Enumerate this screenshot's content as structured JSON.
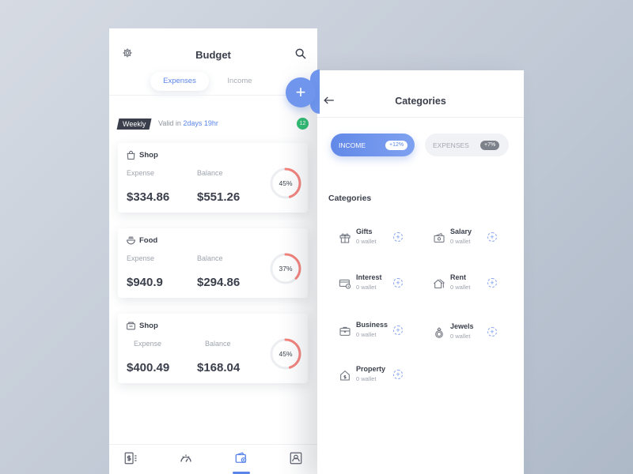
{
  "budget": {
    "title": "Budget",
    "tabs": [
      {
        "label": "Expenses",
        "active": true
      },
      {
        "label": "Income",
        "active": false
      }
    ],
    "fab_label": "+",
    "period_tag": "Weekly",
    "valid_prefix": "Valid in ",
    "valid_time": "2days 19hr",
    "count_badge": "12",
    "cards": [
      {
        "title": "Shop",
        "icon": "shopping-bag-icon",
        "expense_label": "Expense",
        "balance_label": "Balance",
        "expense": "$334.86",
        "balance": "$551.26",
        "percent_label": "45%",
        "percent": 45
      },
      {
        "title": "Food",
        "icon": "bowl-icon",
        "expense_label": "Expense",
        "balance_label": "Balance",
        "expense": "$940.9",
        "balance": "$294.86",
        "percent_label": "37%",
        "percent": 37
      },
      {
        "title": "Shop",
        "icon": "register-icon",
        "expense_label": "Expense",
        "balance_label": "Balance",
        "expense": "$400.49",
        "balance": "$168.04",
        "percent_label": "45%",
        "percent": 45
      }
    ],
    "nav": [
      "budget-list-icon",
      "speedometer-icon",
      "wallet-icon",
      "profile-icon"
    ],
    "active_nav": 2
  },
  "categories": {
    "title": "Categories",
    "toggle": {
      "income_label": "INCOME",
      "income_badge": "+12%",
      "expenses_label": "EXPENSES",
      "expenses_badge": "+7%"
    },
    "section_title": "Categories",
    "items": [
      {
        "name": "Gifts",
        "sub": "0 wallet",
        "icon": "gift-icon"
      },
      {
        "name": "Salary",
        "sub": "0 wallet",
        "icon": "cash-icon"
      },
      {
        "name": "Interest",
        "sub": "0 wallet",
        "icon": "card-icon"
      },
      {
        "name": "Rent",
        "sub": "0 wallet",
        "icon": "house-icon"
      },
      {
        "name": "Business",
        "sub": "0 wallet",
        "icon": "briefcase-icon"
      },
      {
        "name": "Jewels",
        "sub": "0 wallet",
        "icon": "ring-icon"
      },
      {
        "name": "Property",
        "sub": "0 wallet",
        "icon": "property-icon"
      }
    ],
    "add_label": "+"
  },
  "colors": {
    "accent": "#5b85e8",
    "ring_progress": "#f4837d",
    "ring_track": "#eceef1",
    "badge_green": "#2fbf73"
  }
}
